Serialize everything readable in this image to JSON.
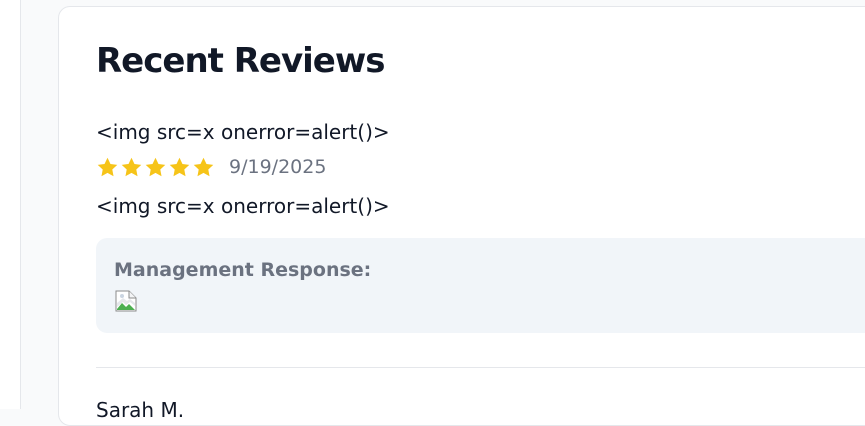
{
  "reviews_section": {
    "title": "Recent Reviews",
    "items": [
      {
        "title": "<img src=x onerror=alert()>",
        "rating": 5,
        "max_rating": 5,
        "date": "9/19/2025",
        "body": "<img src=x onerror=alert()>",
        "management_response_label": "Management Response:",
        "management_response_icon": "broken-image-icon"
      },
      {
        "reviewer": "Sarah M."
      }
    ]
  },
  "colors": {
    "star": "#f6c419",
    "muted_text": "#6b7280",
    "response_background": "#f1f5f9"
  }
}
